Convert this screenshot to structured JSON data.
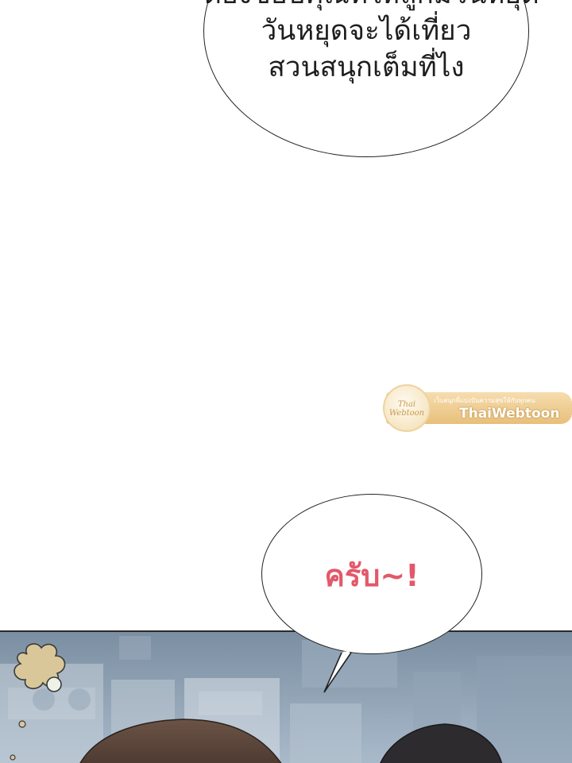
{
  "speech_bubble_top": {
    "lines": [
      "ต้องขอบคุณที่ให้ลูกมีวันหยุด",
      "วันหยุดจะได้เที่ยว",
      "สวนสนุกเต็มที่ไง"
    ]
  },
  "speech_bubble_bottom": {
    "text": "ครับ~!"
  },
  "watermark": {
    "logo_text": "Thai Webtoon",
    "tagline": "เว็บสนุกที่แบ่งปันความสุขให้กับทุกคน",
    "brand": "ThaiWebtoon"
  },
  "colors": {
    "bubble_bottom_text": "#e2596a",
    "watermark_gold": "#e5b86c",
    "scene_sky": "#8ea2b5",
    "flower_fill": "#d9c79a"
  },
  "icons": [
    "flower-icon"
  ]
}
